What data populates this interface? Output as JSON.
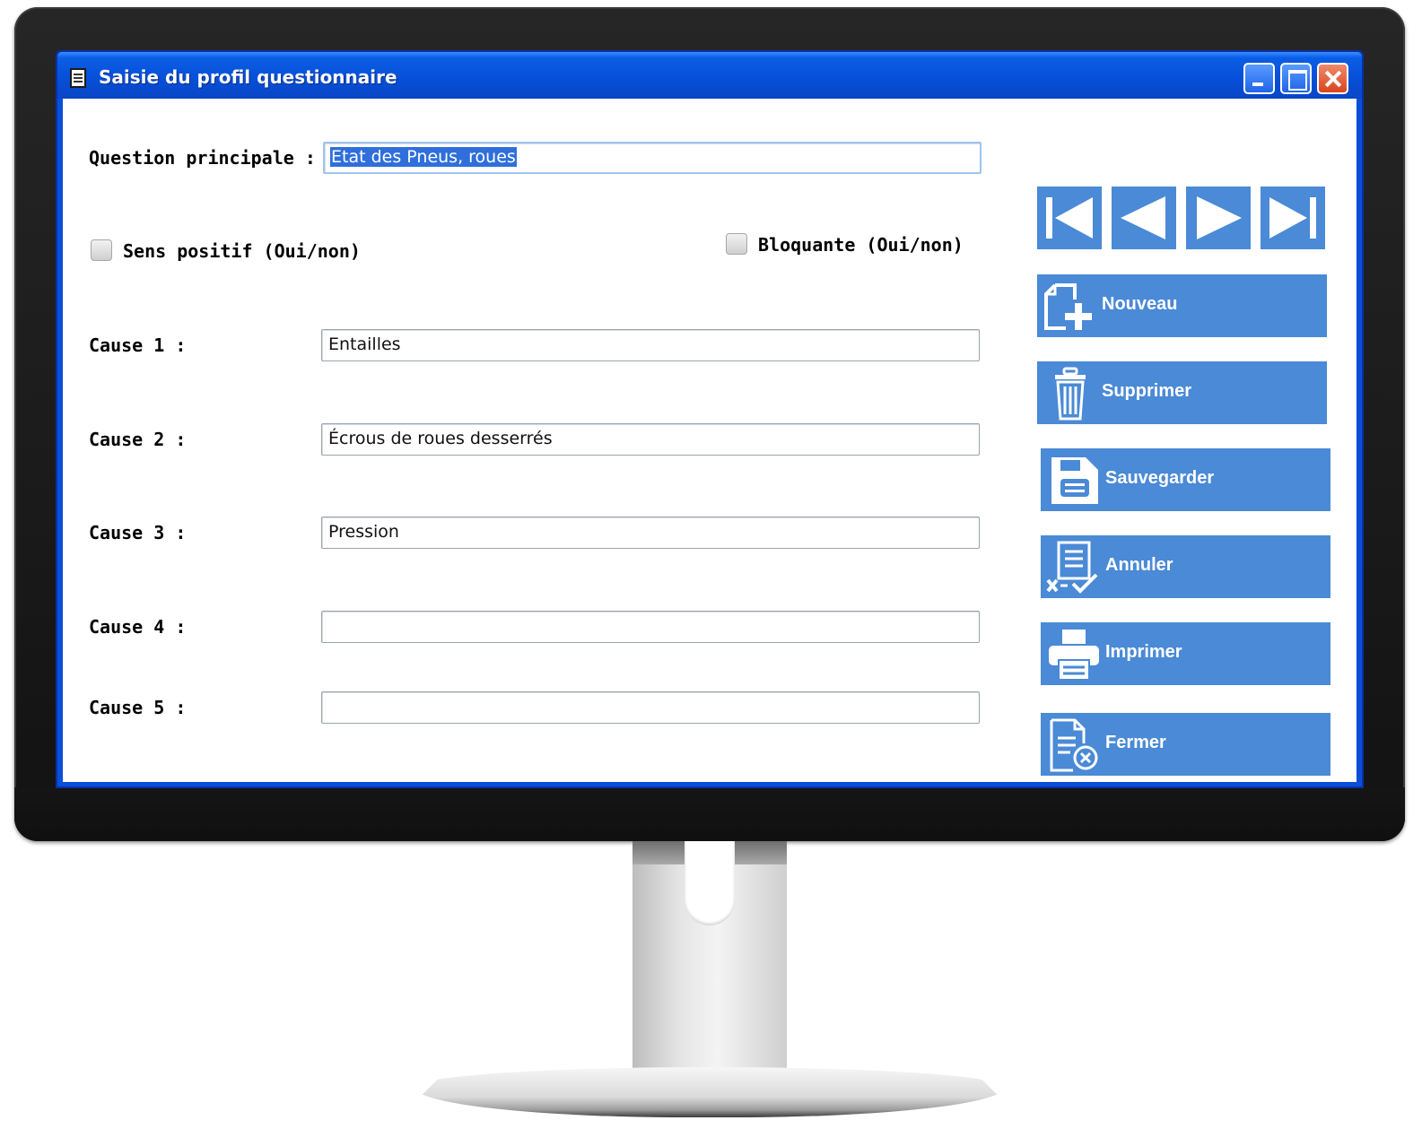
{
  "window": {
    "title": "Saisie du profil questionnaire"
  },
  "form": {
    "question_label": "Question principale :",
    "question_value": "Etat des Pneus, roues",
    "sens_positif_label": "Sens positif (Oui/non)",
    "sens_positif_checked": false,
    "bloquante_label": "Bloquante (Oui/non)",
    "bloquante_checked": false,
    "causes": [
      {
        "label": "Cause 1 :",
        "value": "Entailles"
      },
      {
        "label": "Cause 2 :",
        "value": "Écrous de roues desserrés"
      },
      {
        "label": "Cause 3 :",
        "value": "Pression"
      },
      {
        "label": "Cause 4 :",
        "value": ""
      },
      {
        "label": "Cause 5 :",
        "value": ""
      }
    ]
  },
  "navigation": {
    "icons": [
      "first-record-icon",
      "previous-record-icon",
      "next-record-icon",
      "last-record-icon"
    ]
  },
  "actions": {
    "new": "Nouveau",
    "delete": "Supprimer",
    "save": "Sauvegarder",
    "cancel": "Annuler",
    "print": "Imprimer",
    "close": "Fermer"
  },
  "colors": {
    "button_blue": "#4a8ad6",
    "titlebar_blue": "#0750d8",
    "selection_blue": "#2f6fdc"
  }
}
